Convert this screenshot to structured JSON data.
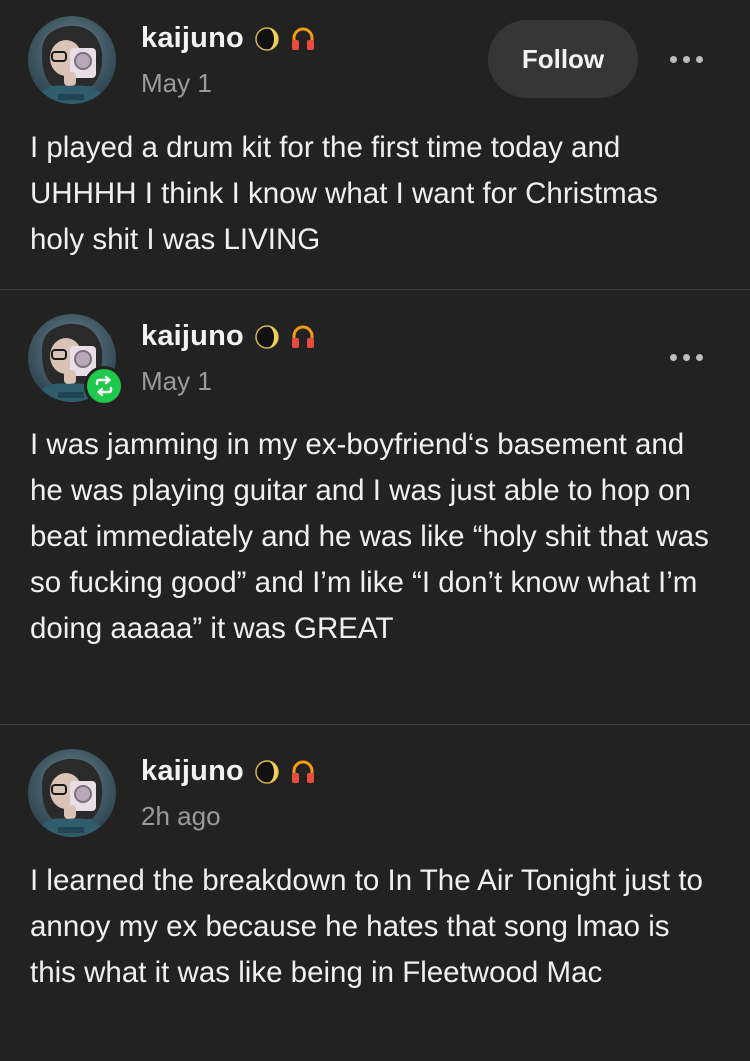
{
  "posts": [
    {
      "username": "kaijuno",
      "timestamp": "May 1",
      "follow_label": "Follow",
      "is_reblog": false,
      "body": "I played a drum kit for the first time today and UHHHH I think I know what I want for Christmas holy shit I was LIVING"
    },
    {
      "username": "kaijuno",
      "timestamp": "May 1",
      "is_reblog": true,
      "body": "I was jamming in my ex-boyfriend‘s basement and he was playing guitar and I was just able to hop on beat immediately and he was like “holy shit that was so fucking good” and I’m like “I don’t know what I’m doing aaaaa” it was GREAT"
    },
    {
      "username": "kaijuno",
      "timestamp": "2h ago",
      "is_reblog": false,
      "body": "I learned the breakdown to In The Air Tonight just to annoy my ex because he hates that song lmao is this what it was like being in Fleetwood Mac"
    }
  ],
  "icons": {
    "username_badges": [
      "moon-icon",
      "headphones-icon"
    ],
    "reblog": "reblog-icon",
    "more": "more-options-icon"
  },
  "colors": {
    "background": "#222222",
    "follow_button": "#363636",
    "reblog_green": "#1fc94b",
    "headphones_orange": "#f39c12",
    "timestamp_gray": "#9b9b9b"
  }
}
